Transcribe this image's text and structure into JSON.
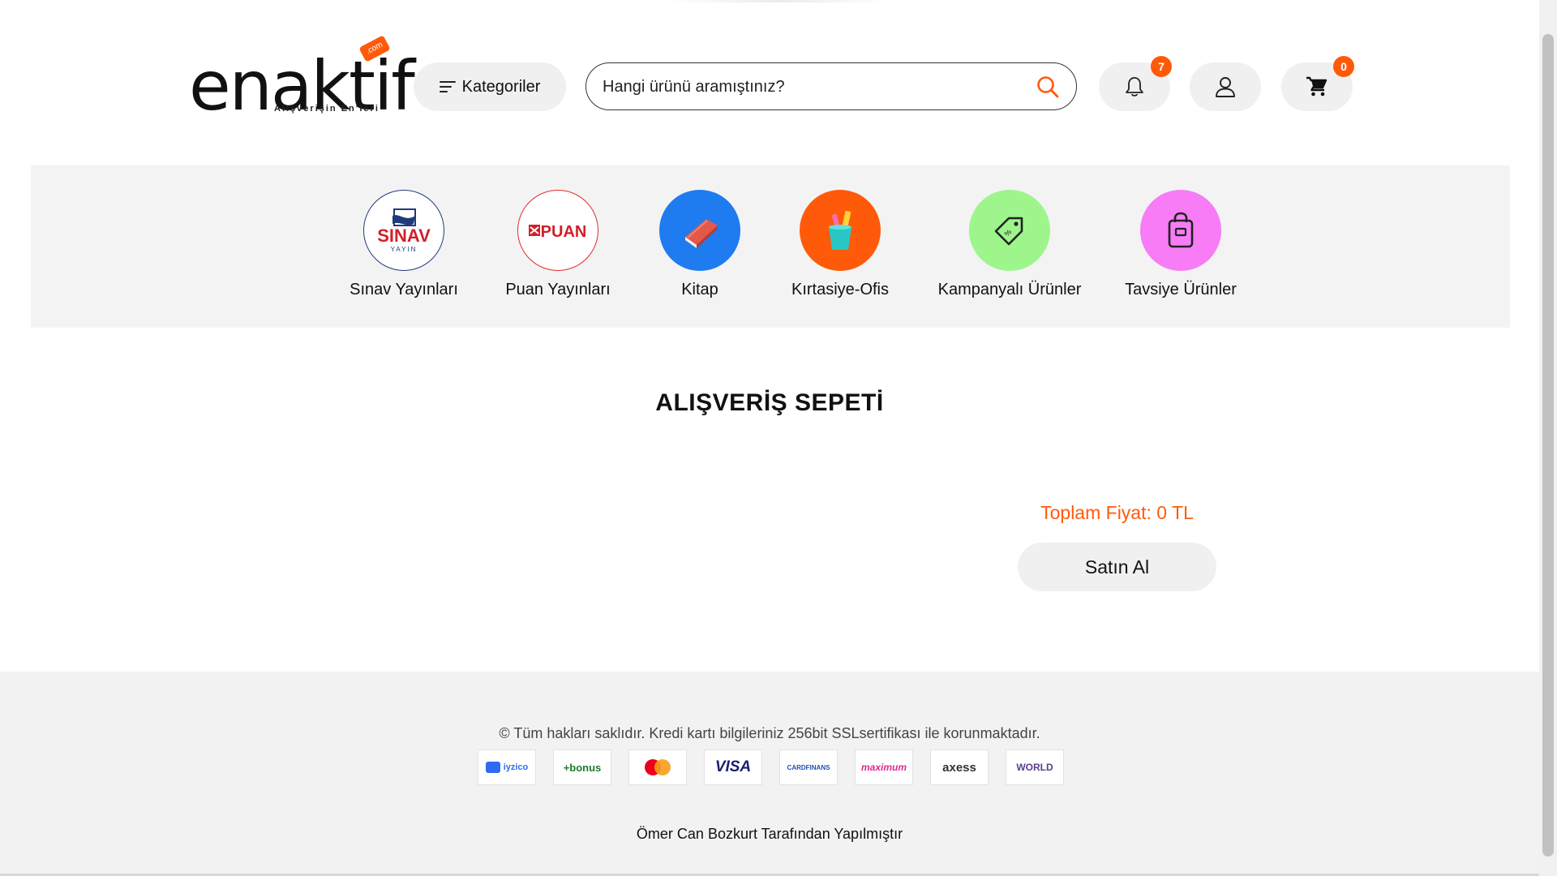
{
  "header": {
    "logo_text": "enaktif",
    "logo_tagline": "Alışverişin En'leri",
    "logo_tag": ".com",
    "categories_label": "Kategoriler",
    "search_placeholder": "Hangi ürünü aramıştınız?",
    "notifications_count": "7",
    "cart_count": "0"
  },
  "categories": [
    {
      "label": "Sınav Yayınları",
      "icon": "sinav-logo",
      "icon_text": "SINAV",
      "icon_subtext": "YAYIN"
    },
    {
      "label": "Puan Yayınları",
      "icon": "puan-logo",
      "icon_text": "PUAN"
    },
    {
      "label": "Kitap",
      "icon": "book-icon",
      "color": "#1e7bf0"
    },
    {
      "label": "Kırtasiye-Ofis",
      "icon": "pencil-cup-icon",
      "color": "#ff5a0a"
    },
    {
      "label": "Kampanyalı Ürünler",
      "icon": "price-tag-icon",
      "color": "#9ef58c"
    },
    {
      "label": "Tavsiye Ürünler",
      "icon": "shopping-bag-icon",
      "color": "#f77cf5"
    }
  ],
  "main": {
    "title": "ALIŞVERİŞ SEPETİ",
    "total_label": "Toplam Fiyat: 0 TL",
    "buy_label": "Satın Al"
  },
  "footer": {
    "copyright": "© Tüm hakları saklıdır. Kredi kartı bilgileriniz 256bit SSLsertifikası ile korunmaktadır.",
    "payment_cards": [
      {
        "name": "iyzico",
        "text": "iyzico"
      },
      {
        "name": "bonus",
        "text": "+bonus"
      },
      {
        "name": "mastercard",
        "text": ""
      },
      {
        "name": "visa",
        "text": "VISA"
      },
      {
        "name": "cardfinans",
        "text": "CARDFINANS"
      },
      {
        "name": "maximum",
        "text": "maximum"
      },
      {
        "name": "axess",
        "text": "axess"
      },
      {
        "name": "world",
        "text": "WORLD"
      }
    ],
    "credit": "Ömer Can Bozkurt Tarafından Yapılmıştır"
  },
  "colors": {
    "accent": "#ff5a0a",
    "pill_bg": "#f0f0f0",
    "band_bg": "#f3f3f3"
  }
}
